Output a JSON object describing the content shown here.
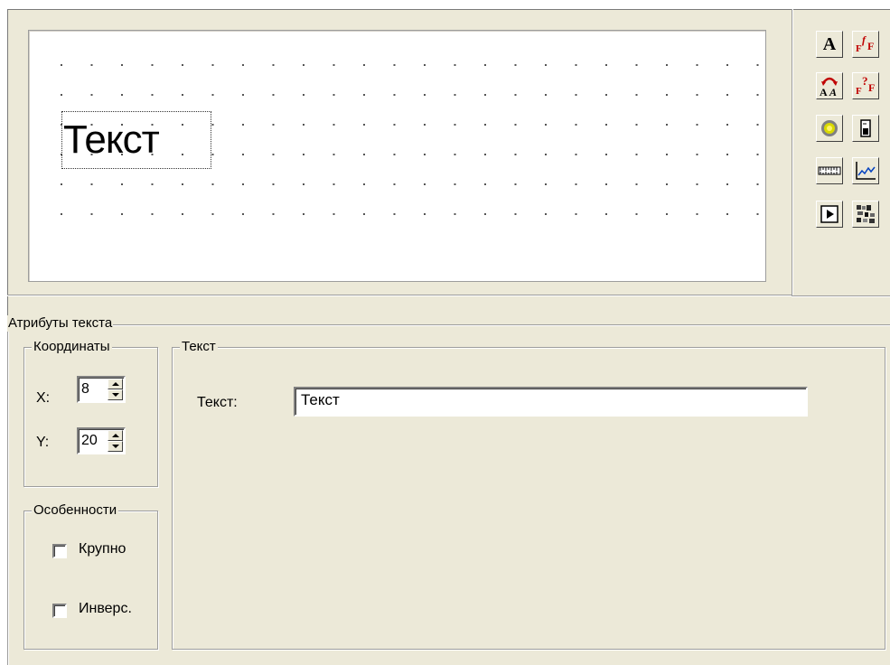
{
  "canvas": {
    "text_item": "Текст"
  },
  "toolbox": {
    "tools": [
      {
        "icon": "text-tool-icon"
      },
      {
        "icon": "formatted-text-tool-icon"
      },
      {
        "icon": "big-text-tool-icon"
      },
      {
        "icon": "formula-tool-icon"
      },
      {
        "icon": "indicator-tool-icon"
      },
      {
        "icon": "bar-tool-icon"
      },
      {
        "icon": "ruler-tool-icon"
      },
      {
        "icon": "graph-tool-icon"
      },
      {
        "icon": "play-tool-icon"
      },
      {
        "icon": "bitmap-tool-icon"
      }
    ]
  },
  "attributes": {
    "title": "Атрибуты текста",
    "coordinates": {
      "title": "Координаты",
      "x_label": "X:",
      "x_value": "8",
      "y_label": "Y:",
      "y_value": "20"
    },
    "features": {
      "title": "Особенности",
      "large_label": "Крупно",
      "large_checked": false,
      "inverse_label": "Инверс.",
      "inverse_checked": false
    },
    "text_group": {
      "title": "Текст",
      "field_label": "Текст:",
      "field_value": "Текст"
    }
  }
}
